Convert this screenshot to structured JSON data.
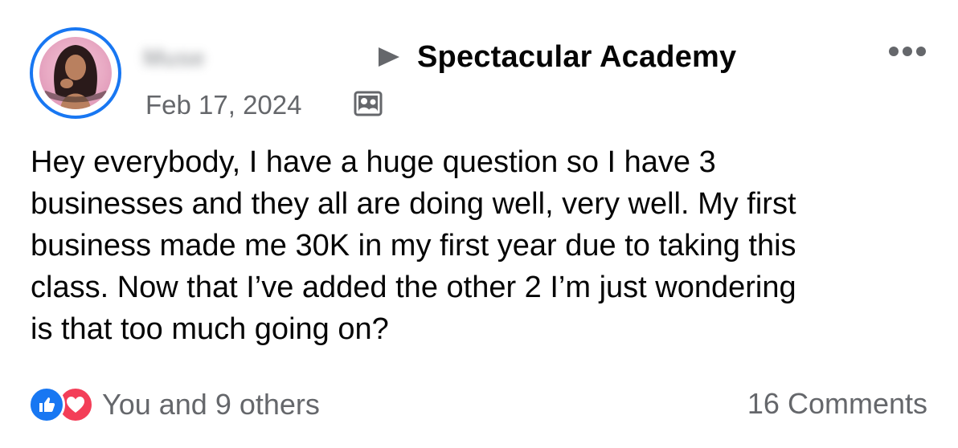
{
  "post": {
    "author_name": "Muse",
    "group_name": "Spectacular Academy",
    "date": "Feb 17, 2024",
    "audience_icon": "group-icon",
    "text": "Hey everybody, I have a huge question so I have 3\nbusinesses and they all are doing well, very well. My first\nbusiness made me 30K in my first year due to taking this\nclass. Now that I’ve added the other 2 I’m just wondering\nis that too much going on?",
    "reactions": {
      "icons": [
        "like-icon",
        "love-icon"
      ],
      "summary": "You and 9 others"
    },
    "comments_label": "16 Comments"
  },
  "colors": {
    "accent": "#1877f2",
    "love": "#f33e58",
    "secondary_text": "#65676b"
  }
}
